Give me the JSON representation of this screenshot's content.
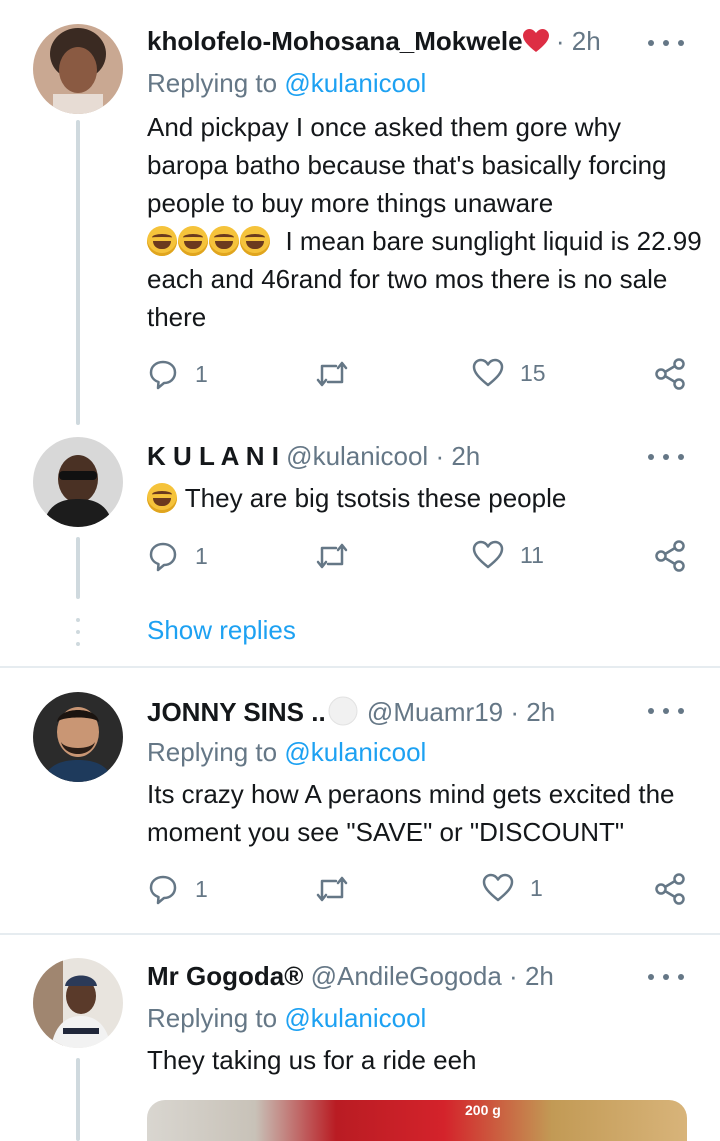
{
  "colors": {
    "link": "#1da1f2",
    "muted": "#657786",
    "text": "#14171a",
    "line": "#cfd9de"
  },
  "tweets": [
    {
      "name": "kholofelo-Mohosana_Mokwele",
      "handle": "",
      "time": "2h",
      "replying_prefix": "Replying to",
      "replying_to": "@kulanicool",
      "text_a": "And pickpay I once asked them gore why baropa batho because that's basically forcing people to buy more things unaware",
      "text_b": "I mean bare sunglight liquid is 22.99 each and 46rand for two mos there is no sale there",
      "emojis": [
        "grinning-squinting-face",
        "rolling-on-floor-laughing",
        "rolling-on-floor-laughing",
        "rolling-on-floor-laughing"
      ],
      "replies": "1",
      "retweets": "",
      "likes": "15"
    },
    {
      "name": "K U L A N I",
      "handle": "@kulanicool",
      "time": "2h",
      "text": "They are big tsotsis these people",
      "emojis": [
        "rolling-on-floor-laughing"
      ],
      "replies": "1",
      "retweets": "",
      "likes": "11"
    },
    {
      "name": "JONNY SINS ..",
      "handle": "@Muamr19",
      "time": "2h",
      "replying_prefix": "Replying to",
      "replying_to": "@kulanicool",
      "text": "Its crazy how A peraons mind gets excited the moment you see \"SAVE\" or \"DISCOUNT\"",
      "replies": "1",
      "retweets": "",
      "likes": "1"
    },
    {
      "name": "Mr Gogoda®",
      "handle": "@AndileGogoda",
      "time": "2h",
      "replying_prefix": "Replying to",
      "replying_to": "@kulanicool",
      "text": "They taking us for a ride eeh",
      "media_label": "200 g"
    }
  ],
  "show_replies": "Show replies",
  "separator": "·"
}
